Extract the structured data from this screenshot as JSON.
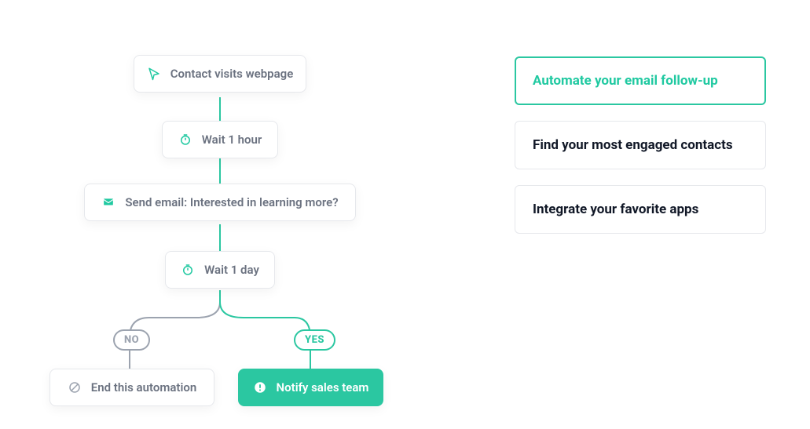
{
  "accent": "#2bc7a1",
  "flow": {
    "start": {
      "label": "Contact visits webpage"
    },
    "wait1": {
      "label": "Wait 1 hour"
    },
    "email": {
      "label": "Send email: Interested in learning more?"
    },
    "wait2": {
      "label": "Wait 1 day"
    },
    "no_pill": "NO",
    "yes_pill": "YES",
    "end": {
      "label": "End this automation"
    },
    "notify": {
      "label": "Notify sales team"
    }
  },
  "options": [
    {
      "label": "Automate your email follow-up",
      "active": true
    },
    {
      "label": "Find your most engaged contacts",
      "active": false
    },
    {
      "label": "Integrate your favorite apps",
      "active": false
    }
  ]
}
